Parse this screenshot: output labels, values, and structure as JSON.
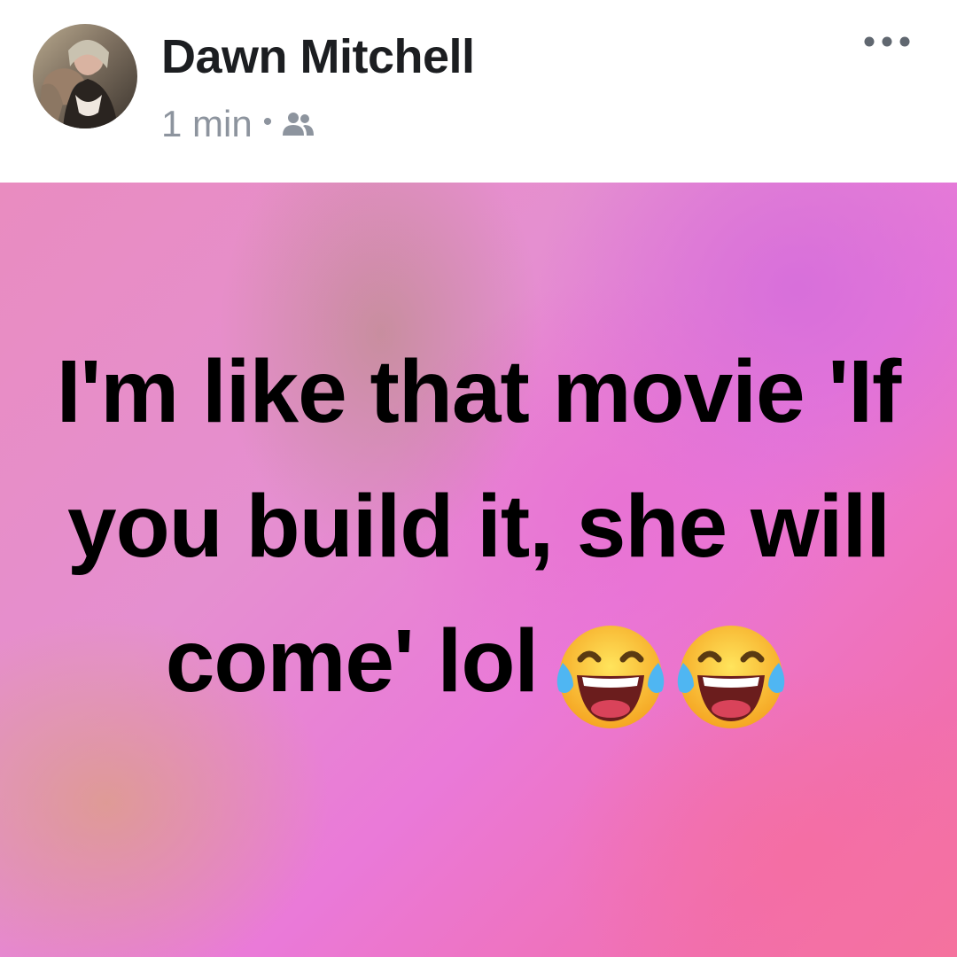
{
  "post": {
    "author": "Dawn Mitchell",
    "timestamp": "1 min",
    "separator": "•",
    "audience_icon": "friends-icon",
    "more_icon": "more-options-icon",
    "status_text": "I'm like that movie 'If you build it, she will come' lol",
    "emojis": [
      "face-with-tears-of-joy-icon",
      "face-with-tears-of-joy-icon"
    ]
  },
  "colors": {
    "name": "#1c1e21",
    "meta": "#8d949e",
    "status_text": "#000000",
    "background_gradient": [
      "#e98cc0",
      "#ea79d8",
      "#f5739d"
    ]
  }
}
